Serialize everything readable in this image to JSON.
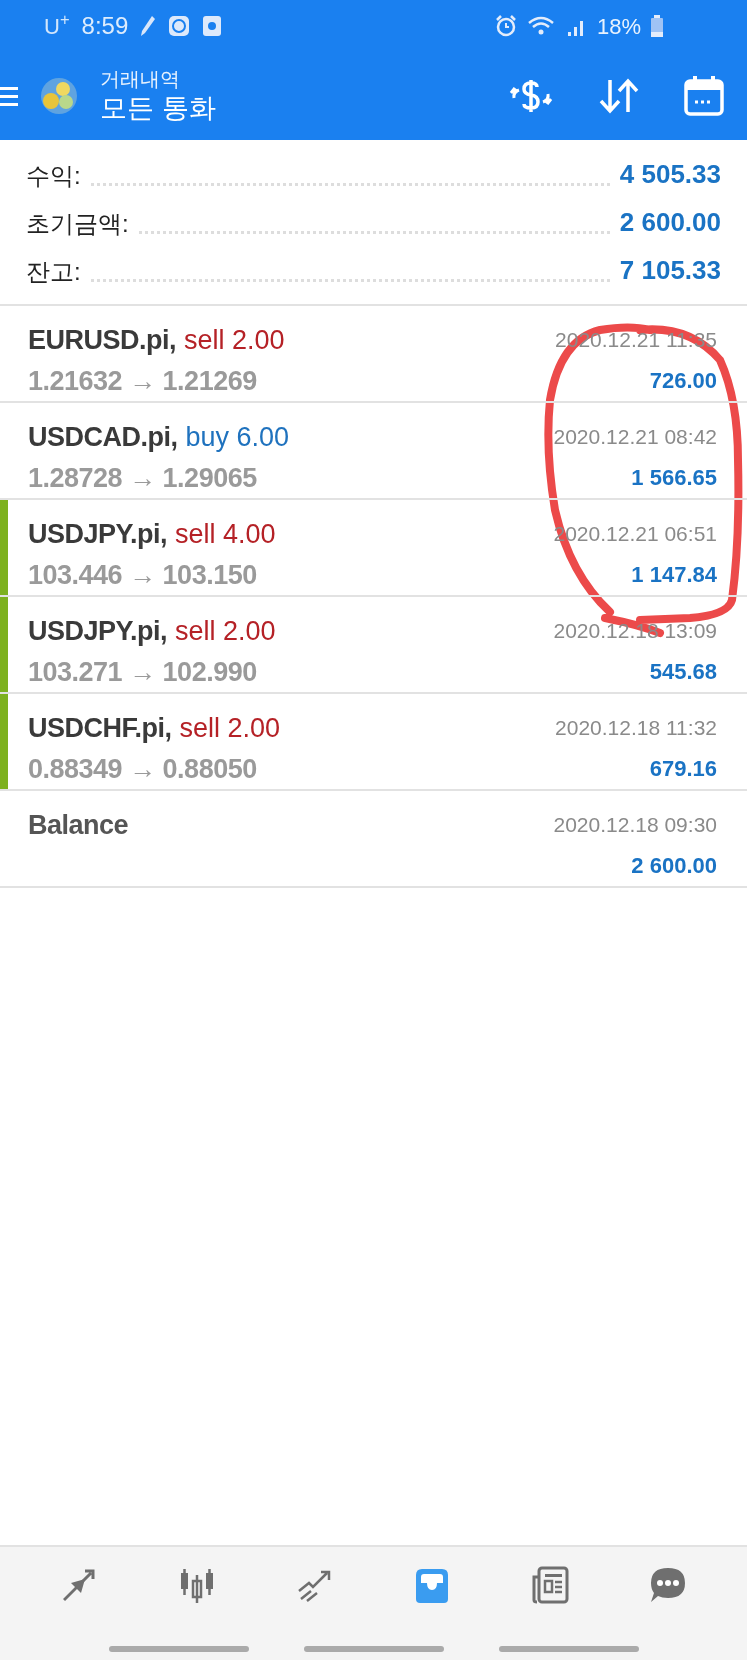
{
  "status_bar": {
    "carrier": "U$^{+}$",
    "time": "8:59",
    "battery": "18%"
  },
  "header": {
    "title": "거래내역",
    "subtitle": "모든 통화"
  },
  "summary": [
    {
      "label": "수익:",
      "value": "4 505.33"
    },
    {
      "label": "초기금액:",
      "value": "2 600.00"
    },
    {
      "label": "잔고:",
      "value": "7 105.33"
    }
  ],
  "deals": [
    {
      "kind": "sell",
      "symbol": "EURUSD.pi,",
      "action": "sell 2.00",
      "prices": "1.21632 → 1.21269",
      "time": "2020.12.21 11:35",
      "profit": "726.00",
      "marked": false
    },
    {
      "kind": "buy",
      "symbol": "USDCAD.pi,",
      "action": "buy 6.00",
      "prices": "1.28728 → 1.29065",
      "time": "2020.12.21 08:42",
      "profit": "1 566.65",
      "marked": false
    },
    {
      "kind": "sell",
      "symbol": "USDJPY.pi,",
      "action": "sell 4.00",
      "prices": "103.446 → 103.150",
      "time": "2020.12.21 06:51",
      "profit": "1 147.84",
      "marked": true
    },
    {
      "kind": "sell",
      "symbol": "USDJPY.pi,",
      "action": "sell 2.00",
      "prices": "103.271 → 102.990",
      "time": "2020.12.18 13:09",
      "profit": "545.68",
      "marked": true
    },
    {
      "kind": "sell",
      "symbol": "USDCHF.pi,",
      "action": "sell 2.00",
      "prices": "0.88349 → 0.88050",
      "time": "2020.12.18 11:32",
      "profit": "679.16",
      "marked": true
    },
    {
      "kind": "balance",
      "symbol": "Balance",
      "time": "2020.12.18 09:30",
      "profit": "2 600.00",
      "marked": false
    }
  ],
  "bottom_nav": [
    {
      "kind": "quotes",
      "selected": false
    },
    {
      "kind": "chart",
      "selected": false
    },
    {
      "kind": "trade",
      "selected": false
    },
    {
      "kind": "history",
      "selected": true
    },
    {
      "kind": "news",
      "selected": false
    },
    {
      "kind": "chat",
      "selected": false
    }
  ]
}
